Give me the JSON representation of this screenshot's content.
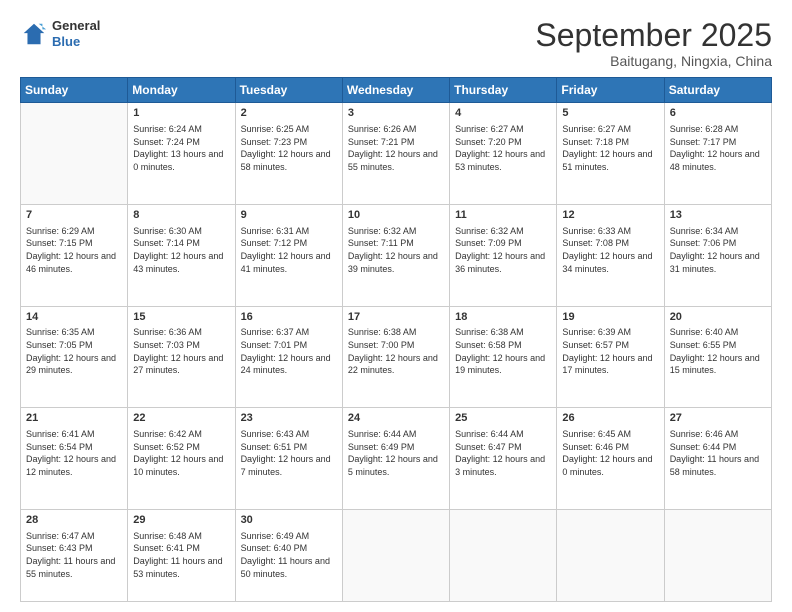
{
  "header": {
    "logo_general": "General",
    "logo_blue": "Blue",
    "month_title": "September 2025",
    "location": "Baitugang, Ningxia, China"
  },
  "days_of_week": [
    "Sunday",
    "Monday",
    "Tuesday",
    "Wednesday",
    "Thursday",
    "Friday",
    "Saturday"
  ],
  "weeks": [
    [
      {
        "day": "",
        "sunrise": "",
        "sunset": "",
        "daylight": ""
      },
      {
        "day": "1",
        "sunrise": "6:24 AM",
        "sunset": "7:24 PM",
        "daylight": "13 hours and 0 minutes."
      },
      {
        "day": "2",
        "sunrise": "6:25 AM",
        "sunset": "7:23 PM",
        "daylight": "12 hours and 58 minutes."
      },
      {
        "day": "3",
        "sunrise": "6:26 AM",
        "sunset": "7:21 PM",
        "daylight": "12 hours and 55 minutes."
      },
      {
        "day": "4",
        "sunrise": "6:27 AM",
        "sunset": "7:20 PM",
        "daylight": "12 hours and 53 minutes."
      },
      {
        "day": "5",
        "sunrise": "6:27 AM",
        "sunset": "7:18 PM",
        "daylight": "12 hours and 51 minutes."
      },
      {
        "day": "6",
        "sunrise": "6:28 AM",
        "sunset": "7:17 PM",
        "daylight": "12 hours and 48 minutes."
      }
    ],
    [
      {
        "day": "7",
        "sunrise": "6:29 AM",
        "sunset": "7:15 PM",
        "daylight": "12 hours and 46 minutes."
      },
      {
        "day": "8",
        "sunrise": "6:30 AM",
        "sunset": "7:14 PM",
        "daylight": "12 hours and 43 minutes."
      },
      {
        "day": "9",
        "sunrise": "6:31 AM",
        "sunset": "7:12 PM",
        "daylight": "12 hours and 41 minutes."
      },
      {
        "day": "10",
        "sunrise": "6:32 AM",
        "sunset": "7:11 PM",
        "daylight": "12 hours and 39 minutes."
      },
      {
        "day": "11",
        "sunrise": "6:32 AM",
        "sunset": "7:09 PM",
        "daylight": "12 hours and 36 minutes."
      },
      {
        "day": "12",
        "sunrise": "6:33 AM",
        "sunset": "7:08 PM",
        "daylight": "12 hours and 34 minutes."
      },
      {
        "day": "13",
        "sunrise": "6:34 AM",
        "sunset": "7:06 PM",
        "daylight": "12 hours and 31 minutes."
      }
    ],
    [
      {
        "day": "14",
        "sunrise": "6:35 AM",
        "sunset": "7:05 PM",
        "daylight": "12 hours and 29 minutes."
      },
      {
        "day": "15",
        "sunrise": "6:36 AM",
        "sunset": "7:03 PM",
        "daylight": "12 hours and 27 minutes."
      },
      {
        "day": "16",
        "sunrise": "6:37 AM",
        "sunset": "7:01 PM",
        "daylight": "12 hours and 24 minutes."
      },
      {
        "day": "17",
        "sunrise": "6:38 AM",
        "sunset": "7:00 PM",
        "daylight": "12 hours and 22 minutes."
      },
      {
        "day": "18",
        "sunrise": "6:38 AM",
        "sunset": "6:58 PM",
        "daylight": "12 hours and 19 minutes."
      },
      {
        "day": "19",
        "sunrise": "6:39 AM",
        "sunset": "6:57 PM",
        "daylight": "12 hours and 17 minutes."
      },
      {
        "day": "20",
        "sunrise": "6:40 AM",
        "sunset": "6:55 PM",
        "daylight": "12 hours and 15 minutes."
      }
    ],
    [
      {
        "day": "21",
        "sunrise": "6:41 AM",
        "sunset": "6:54 PM",
        "daylight": "12 hours and 12 minutes."
      },
      {
        "day": "22",
        "sunrise": "6:42 AM",
        "sunset": "6:52 PM",
        "daylight": "12 hours and 10 minutes."
      },
      {
        "day": "23",
        "sunrise": "6:43 AM",
        "sunset": "6:51 PM",
        "daylight": "12 hours and 7 minutes."
      },
      {
        "day": "24",
        "sunrise": "6:44 AM",
        "sunset": "6:49 PM",
        "daylight": "12 hours and 5 minutes."
      },
      {
        "day": "25",
        "sunrise": "6:44 AM",
        "sunset": "6:47 PM",
        "daylight": "12 hours and 3 minutes."
      },
      {
        "day": "26",
        "sunrise": "6:45 AM",
        "sunset": "6:46 PM",
        "daylight": "12 hours and 0 minutes."
      },
      {
        "day": "27",
        "sunrise": "6:46 AM",
        "sunset": "6:44 PM",
        "daylight": "11 hours and 58 minutes."
      }
    ],
    [
      {
        "day": "28",
        "sunrise": "6:47 AM",
        "sunset": "6:43 PM",
        "daylight": "11 hours and 55 minutes."
      },
      {
        "day": "29",
        "sunrise": "6:48 AM",
        "sunset": "6:41 PM",
        "daylight": "11 hours and 53 minutes."
      },
      {
        "day": "30",
        "sunrise": "6:49 AM",
        "sunset": "6:40 PM",
        "daylight": "11 hours and 50 minutes."
      },
      {
        "day": "",
        "sunrise": "",
        "sunset": "",
        "daylight": ""
      },
      {
        "day": "",
        "sunrise": "",
        "sunset": "",
        "daylight": ""
      },
      {
        "day": "",
        "sunrise": "",
        "sunset": "",
        "daylight": ""
      },
      {
        "day": "",
        "sunrise": "",
        "sunset": "",
        "daylight": ""
      }
    ]
  ],
  "labels": {
    "sunrise_prefix": "Sunrise: ",
    "sunset_prefix": "Sunset: ",
    "daylight_prefix": "Daylight: "
  }
}
